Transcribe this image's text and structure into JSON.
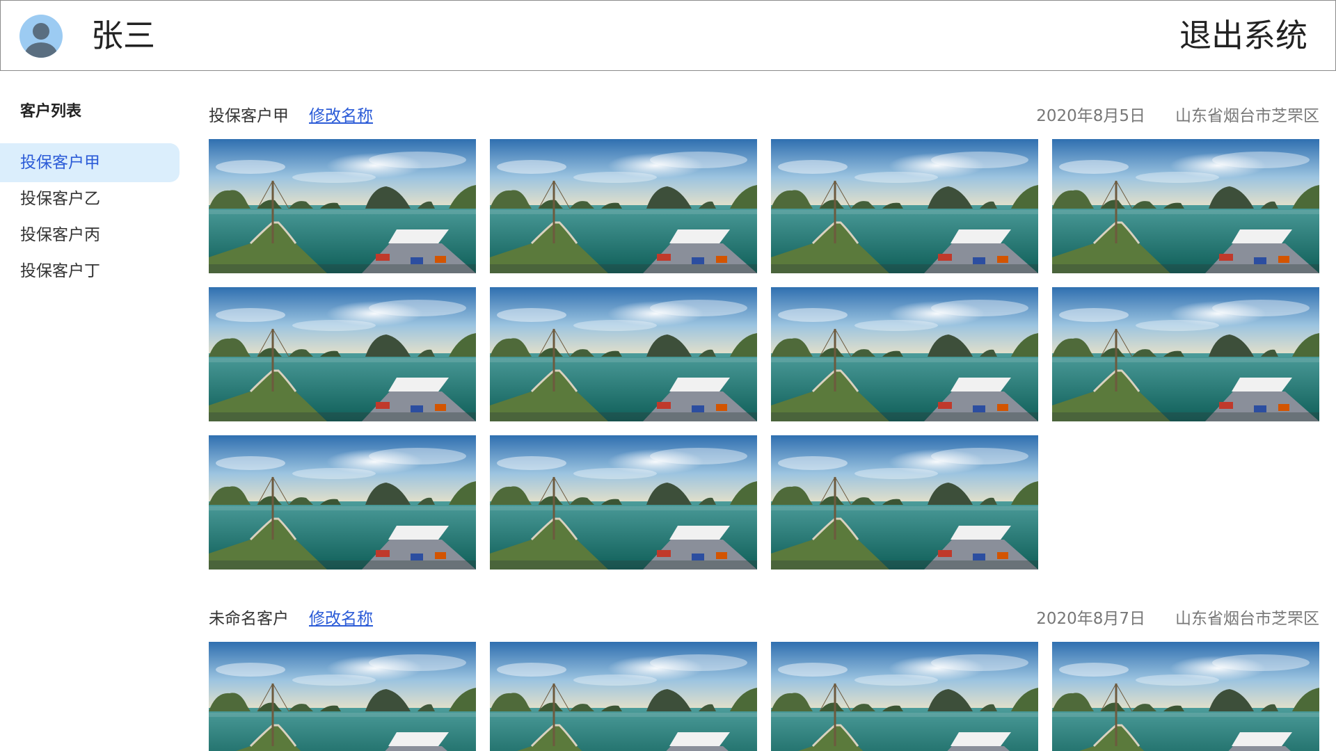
{
  "header": {
    "username": "张三",
    "logout_label": "退出系统"
  },
  "sidebar": {
    "title": "客户列表",
    "items": [
      {
        "label": "投保客户甲",
        "active": true
      },
      {
        "label": "投保客户乙",
        "active": false
      },
      {
        "label": "投保客户丙",
        "active": false
      },
      {
        "label": "投保客户丁",
        "active": false
      }
    ]
  },
  "sections": [
    {
      "name": "投保客户甲",
      "rename_label": "修改名称",
      "date": "2020年8月5日",
      "location": "山东省烟台市芝罘区",
      "photo_count": 11
    },
    {
      "name": "未命名客户",
      "rename_label": "修改名称",
      "date": "2020年8月7日",
      "location": "山东省烟台市芝罘区",
      "photo_count": 4
    }
  ],
  "icons": {
    "avatar": "user-avatar-icon"
  },
  "colors": {
    "accent": "#2b5bd7",
    "active_bg": "#dbeefc",
    "muted_text": "#777777"
  }
}
